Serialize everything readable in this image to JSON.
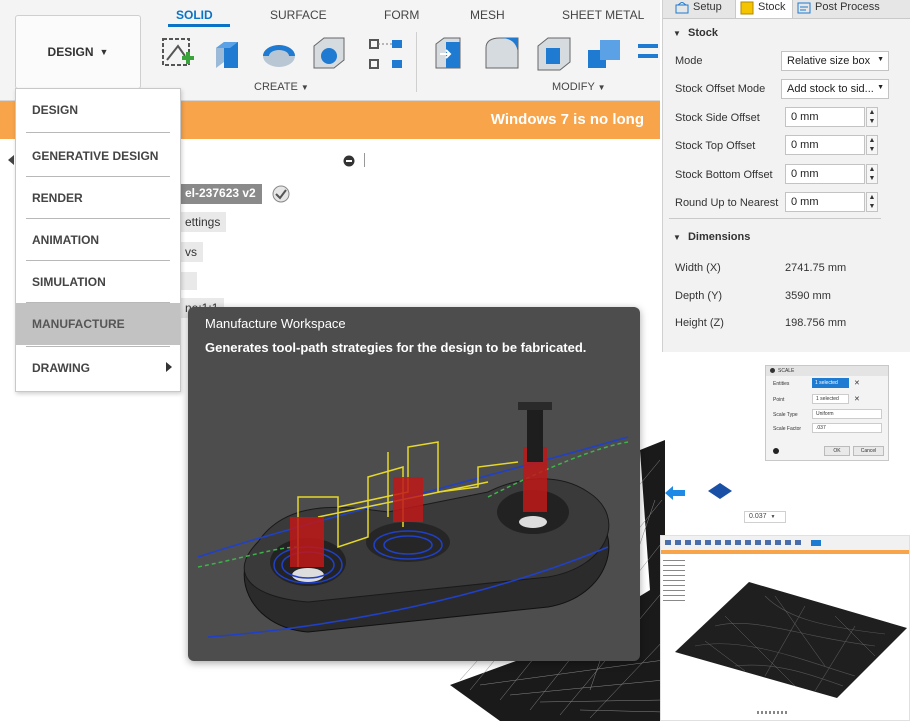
{
  "toolbar": {
    "workspace_button": "DESIGN",
    "tabs": [
      "SOLID",
      "SURFACE",
      "FORM",
      "MESH",
      "SHEET METAL"
    ],
    "create_label": "CREATE",
    "modify_label": "MODIFY"
  },
  "banner": {
    "text": "Windows 7 is no long"
  },
  "workspace_menu": {
    "items": [
      "DESIGN",
      "GENERATIVE DESIGN",
      "RENDER",
      "ANIMATION",
      "SIMULATION",
      "MANUFACTURE",
      "DRAWING"
    ],
    "highlighted": "MANUFACTURE"
  },
  "browser": {
    "component_name": "el-237623 v2",
    "settings_label": "ettings",
    "views_label": "vs",
    "origin_label": "",
    "partial_label": "ne:1:1"
  },
  "tooltip": {
    "title": "Manufacture Workspace",
    "description": "Generates tool-path strategies for the design to be fabricated."
  },
  "stock_panel": {
    "tabs": [
      "Setup",
      "Stock",
      "Post Process"
    ],
    "stock_section": "Stock",
    "rows": [
      {
        "label": "Mode",
        "value": "Relative size box"
      },
      {
        "label": "Stock Offset Mode",
        "value": "Add stock to sid..."
      },
      {
        "label": "Stock Side Offset",
        "value": "0 mm"
      },
      {
        "label": "Stock Top Offset",
        "value": "0 mm"
      },
      {
        "label": "Stock Bottom Offset",
        "value": "0 mm"
      },
      {
        "label": "Round Up to Nearest",
        "value": "0 mm"
      }
    ],
    "dimensions_section": "Dimensions",
    "dimensions": [
      {
        "label": "Width (X)",
        "value": "2741.75 mm"
      },
      {
        "label": "Depth (Y)",
        "value": "3590 mm"
      },
      {
        "label": "Height (Z)",
        "value": "198.756 mm"
      }
    ]
  },
  "scale_dialog": {
    "title": "SCALE",
    "entities_label": "Entities",
    "entities_value": "1 selected",
    "point_label": "Point",
    "point_value": "1 selected",
    "scale_type_label": "Scale Type",
    "scale_type_value": "Uniform",
    "scale_factor_label": "Scale Factor",
    "scale_factor_value": ".037",
    "ok_label": "OK",
    "cancel_label": "Cancel"
  },
  "scale_readout": {
    "value": "0.037"
  },
  "colors": {
    "accent": "#0a73c6",
    "banner": "#f7a44b",
    "tooltip_bg": "#4d4d4d",
    "menu_highlight": "#c2c2c2"
  }
}
